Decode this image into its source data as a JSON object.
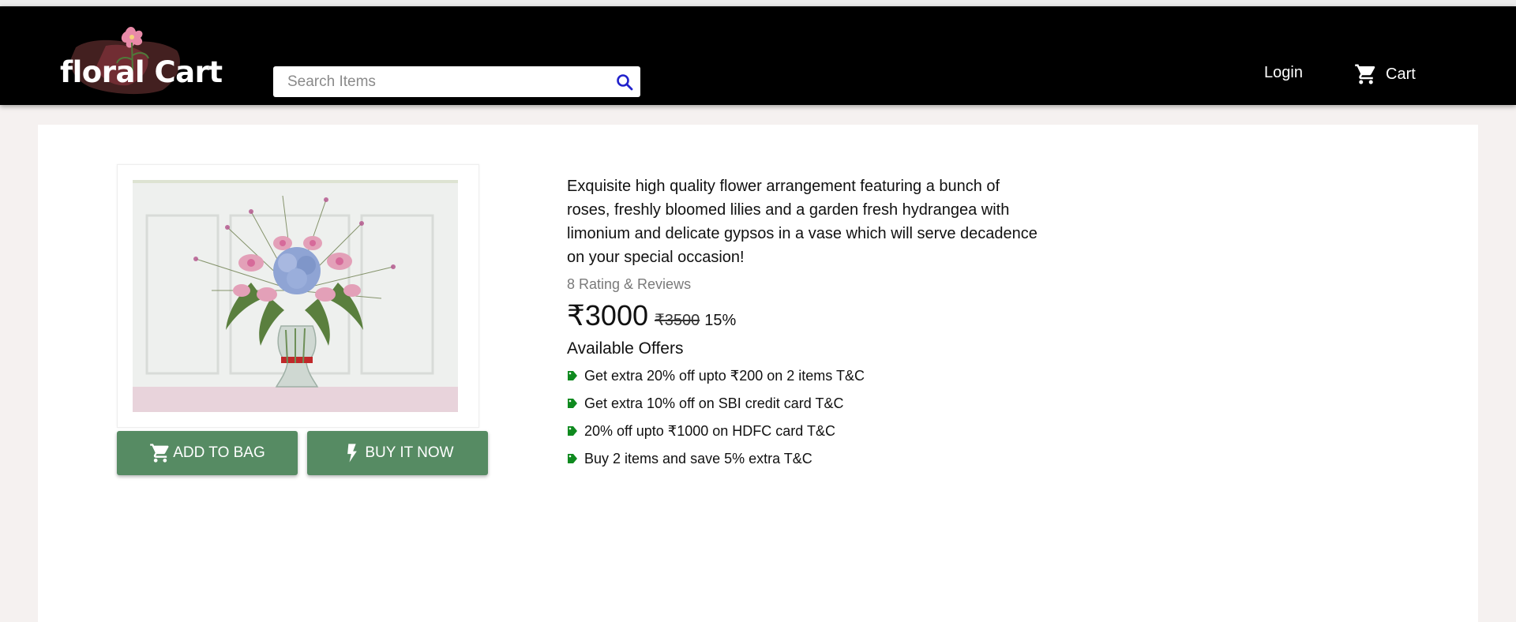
{
  "header": {
    "logo_text": "floral Cart",
    "search": {
      "placeholder": "Search Items",
      "value": "",
      "icon": "search-icon"
    },
    "login_label": "Login",
    "cart_label": "Cart",
    "cart_icon": "cart-icon"
  },
  "product": {
    "image_alt": "flower vase arrangement",
    "description": "Exquisite high quality flower arrangement featuring a bunch of roses, freshly bloomed lilies and a garden fresh hydrangea with limonium and delicate gypsos in a vase which will serve decadence on your special occasion!",
    "rating_text": "8 Rating & Reviews",
    "price": "₹3000",
    "original_price": "₹3500",
    "discount": "15%",
    "offers_title": "Available Offers",
    "offers": [
      " Get extra 20% off upto ₹200 on 2 items T&C",
      "Get extra 10% off on SBI credit card T&C",
      " 20% off upto ₹1000 on HDFC card T&C",
      "Buy 2 items and save 5% extra T&C"
    ],
    "add_to_bag_label": "ADD TO BAG",
    "buy_now_label": "BUY IT NOW"
  },
  "colors": {
    "header_bg": "#000000",
    "button_green": "#568b63",
    "tag_green": "#0f8a1f",
    "search_icon": "#2222cc"
  }
}
